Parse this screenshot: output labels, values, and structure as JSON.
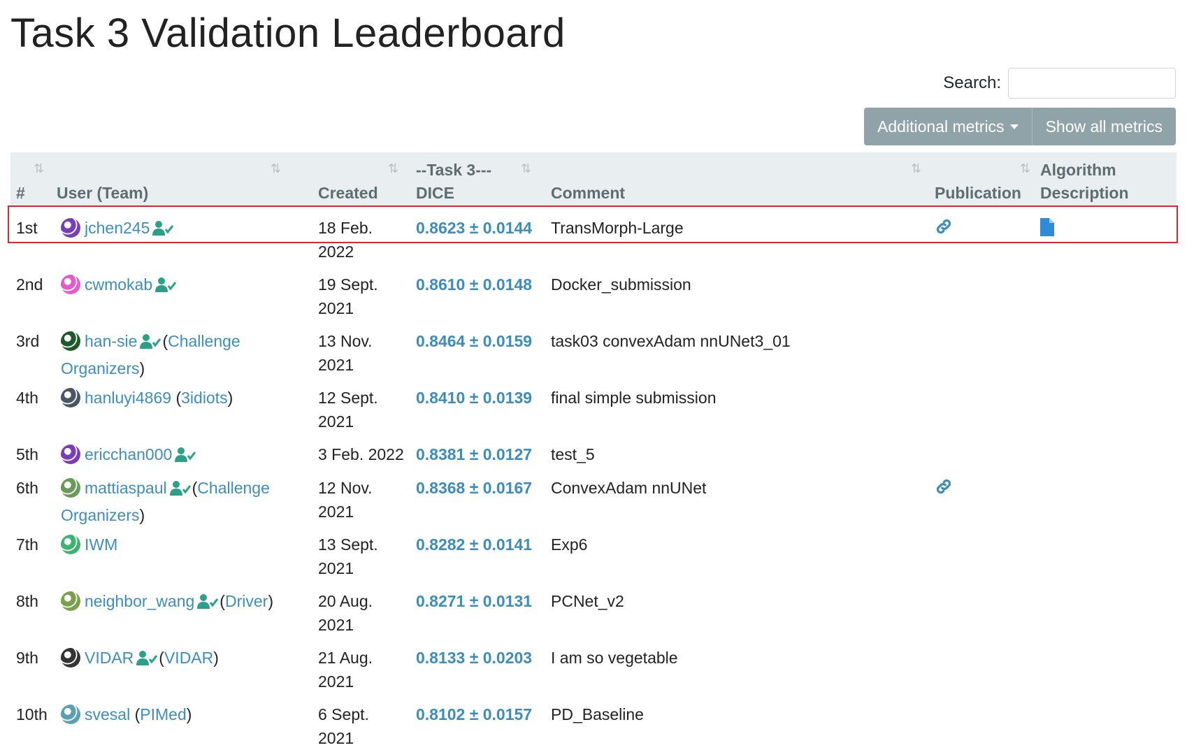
{
  "page": {
    "title": "Task 3 Validation Leaderboard"
  },
  "search": {
    "label": "Search:",
    "value": ""
  },
  "buttons": {
    "additional_metrics": "Additional metrics",
    "show_all_metrics": "Show all metrics"
  },
  "table": {
    "headers": {
      "rank": "#",
      "user": "User (Team)",
      "created": "Created",
      "task_group": "--Task 3---",
      "dice": "DICE",
      "comment": "Comment",
      "publication": "Publication",
      "algorithm_1": "Algorithm",
      "algorithm_2": "Description"
    },
    "rows": [
      {
        "rank": "1st",
        "user": "jchen245",
        "team": "",
        "verified": true,
        "created_1": "18 Feb.",
        "created_2": "2022",
        "dice": "0.8623 ± 0.0144",
        "comment": "TransMorph-Large",
        "publication": true,
        "algorithm": true,
        "avatar_color": "#7a3db8",
        "highlighted": true
      },
      {
        "rank": "2nd",
        "user": "cwmokab",
        "team": "",
        "verified": true,
        "created_1": "19 Sept.",
        "created_2": "2021",
        "dice": "0.8610 ± 0.0148",
        "comment": "Docker_submission",
        "publication": false,
        "algorithm": false,
        "avatar_color": "#e05ccf"
      },
      {
        "rank": "3rd",
        "user": "han-sie",
        "team": "Challenge Organizers",
        "verified": true,
        "created_1": "13 Nov.",
        "created_2": "2021",
        "dice": "0.8464 ± 0.0159",
        "comment": "task03 convexAdam nnUNet3_01",
        "publication": false,
        "algorithm": false,
        "avatar_color": "#1f5a2a"
      },
      {
        "rank": "4th",
        "user": "hanluyi4869",
        "team": "3idiots",
        "verified": false,
        "created_1": "12 Sept.",
        "created_2": "2021",
        "dice": "0.8410 ± 0.0139",
        "comment": "final simple submission",
        "publication": false,
        "algorithm": false,
        "avatar_color": "#4a5566"
      },
      {
        "rank": "5th",
        "user": "ericchan000",
        "team": "",
        "verified": true,
        "created_1": "3 Feb. 2022",
        "created_2": "",
        "dice": "0.8381 ± 0.0127",
        "comment": "test_5",
        "publication": false,
        "algorithm": false,
        "avatar_color": "#7a3db8"
      },
      {
        "rank": "6th",
        "user": "mattiaspaul",
        "team": "Challenge Organizers",
        "verified": true,
        "created_1": "12 Nov.",
        "created_2": "2021",
        "dice": "0.8368 ± 0.0167",
        "comment": "ConvexAdam nnUNet",
        "publication": true,
        "algorithm": false,
        "avatar_color": "#6a9a5a"
      },
      {
        "rank": "7th",
        "user": "IWM",
        "team": "",
        "verified": false,
        "created_1": "13 Sept.",
        "created_2": "2021",
        "dice": "0.8282 ± 0.0141",
        "comment": "Exp6",
        "publication": false,
        "algorithm": false,
        "avatar_color": "#3cb371"
      },
      {
        "rank": "8th",
        "user": "neighbor_wang",
        "team": "Driver",
        "verified": true,
        "created_1": "20 Aug.",
        "created_2": "2021",
        "dice": "0.8271 ± 0.0131",
        "comment": "PCNet_v2",
        "publication": false,
        "algorithm": false,
        "avatar_color": "#7aa04a"
      },
      {
        "rank": "9th",
        "user": "VIDAR",
        "team": "VIDAR",
        "verified": true,
        "created_1": "21 Aug.",
        "created_2": "2021",
        "dice": "0.8133 ± 0.0203",
        "comment": "I am so vegetable",
        "publication": false,
        "algorithm": false,
        "avatar_color": "#333333"
      },
      {
        "rank": "10th",
        "user": "svesal",
        "team": "PIMed",
        "verified": false,
        "created_1": "6 Sept. 2021",
        "created_2": "",
        "dice": "0.8102 ± 0.0157",
        "comment": "PD_Baseline",
        "publication": false,
        "algorithm": false,
        "avatar_color": "#5aa0b0"
      }
    ]
  },
  "colors": {
    "link": "#3c8dbc",
    "verified": "#2aa088",
    "button": "#8fa3a8",
    "highlight": "#e0252b"
  }
}
